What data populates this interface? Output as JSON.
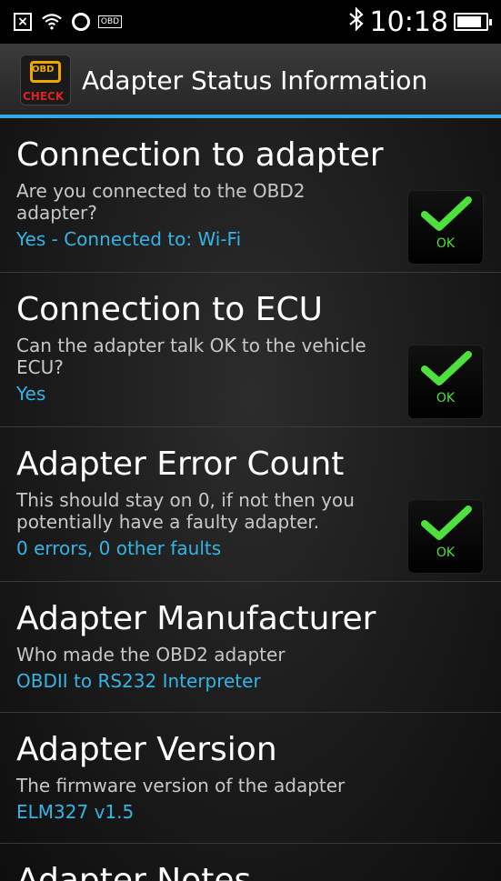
{
  "statusbar": {
    "time": "10:18",
    "battery_level": 0.85
  },
  "actionbar": {
    "title": "Adapter Status Information",
    "icon_text": "OBD",
    "icon_check": "CHECK"
  },
  "items": [
    {
      "title": "Connection to adapter",
      "desc": "Are you connected to the OBD2 adapter?",
      "value": "Yes - Connected to: Wi-Fi",
      "status": "OK"
    },
    {
      "title": "Connection to ECU",
      "desc": "Can the adapter talk OK to the vehicle ECU?",
      "value": "Yes",
      "status": "OK"
    },
    {
      "title": "Adapter Error Count",
      "desc": "This should stay on 0, if not then you potentially have a faulty adapter.",
      "value": "0 errors, 0 other faults",
      "status": "OK"
    },
    {
      "title": "Adapter Manufacturer",
      "desc": "Who made the OBD2 adapter",
      "value": "OBDII to RS232 Interpreter"
    },
    {
      "title": "Adapter Version",
      "desc": "The firmware version of the adapter",
      "value": "ELM327 v1.5"
    },
    {
      "title": "Adapter Notes"
    }
  ],
  "colors": {
    "accent": "#33b5e5",
    "ok_green": "#4ee03c"
  }
}
